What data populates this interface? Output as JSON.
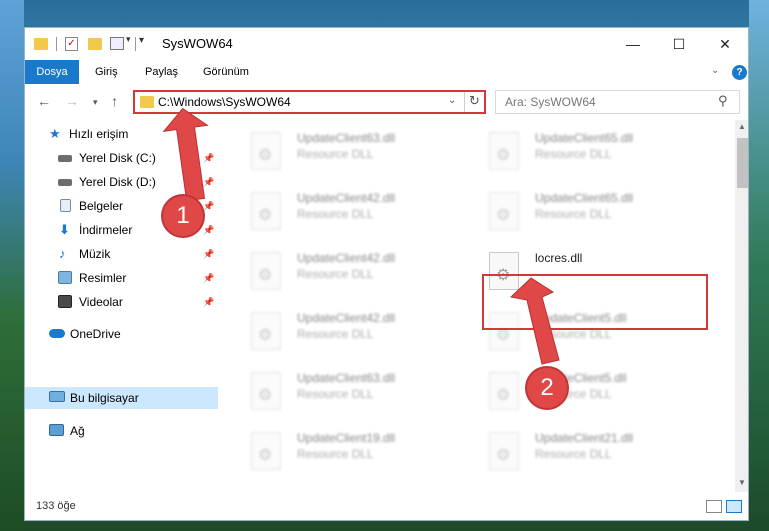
{
  "window": {
    "title": "SysWOW64",
    "controls": {
      "minimize": "—",
      "maximize": "☐",
      "close": "✕"
    }
  },
  "ribbon": {
    "tabs": [
      "Dosya",
      "Giriş",
      "Paylaş",
      "Görünüm"
    ],
    "help": "?"
  },
  "address": {
    "path": "C:\\Windows\\SysWOW64",
    "search_placeholder": "Ara: SysWOW64"
  },
  "nav_pane": {
    "items": [
      {
        "label": "Hızlı erişim",
        "icon": "star-icon"
      },
      {
        "label": "Yerel Disk (C:)",
        "icon": "drive-icon",
        "pinned": true
      },
      {
        "label": "Yerel Disk (D:)",
        "icon": "drive-icon",
        "pinned": true
      },
      {
        "label": "Belgeler",
        "icon": "documents-icon",
        "pinned": true
      },
      {
        "label": "İndirmeler",
        "icon": "download-icon",
        "pinned": true
      },
      {
        "label": "Müzik",
        "icon": "music-icon",
        "pinned": true
      },
      {
        "label": "Resimler",
        "icon": "pictures-icon",
        "pinned": true
      },
      {
        "label": "Videolar",
        "icon": "videos-icon",
        "pinned": true
      },
      {
        "label": "OneDrive",
        "icon": "cloud-icon"
      },
      {
        "label": "Bu bilgisayar",
        "icon": "computer-icon",
        "selected": true
      },
      {
        "label": "Ağ",
        "icon": "network-icon"
      }
    ]
  },
  "files": [
    {
      "name": "UpdateClient63.dll",
      "type": "Resource DLL"
    },
    {
      "name": "UpdateClient65.dll",
      "type": "Resource DLL"
    },
    {
      "name": "UpdateClient42.dll",
      "type": "Resource DLL"
    },
    {
      "name": "UpdateClient65.dll",
      "type": "Resource DLL"
    },
    {
      "name": "UpdateClient42.dll",
      "type": "Resource DLL"
    },
    {
      "name": "locres.dll",
      "type": ""
    },
    {
      "name": "UpdateClient42.dll",
      "type": "Resource DLL"
    },
    {
      "name": "UpdateClient5.dll",
      "type": "Resource DLL"
    },
    {
      "name": "UpdateClient63.dll",
      "type": "Resource DLL"
    },
    {
      "name": "UpdateClient5.dll",
      "type": "Resource DLL"
    },
    {
      "name": "UpdateClient19.dll",
      "type": "Resource DLL"
    },
    {
      "name": "UpdateClient21.dll",
      "type": "Resource DLL"
    }
  ],
  "status": {
    "count": "133 öğe"
  },
  "annotations": {
    "step1": "1",
    "step2": "2",
    "color": "#e04848"
  }
}
